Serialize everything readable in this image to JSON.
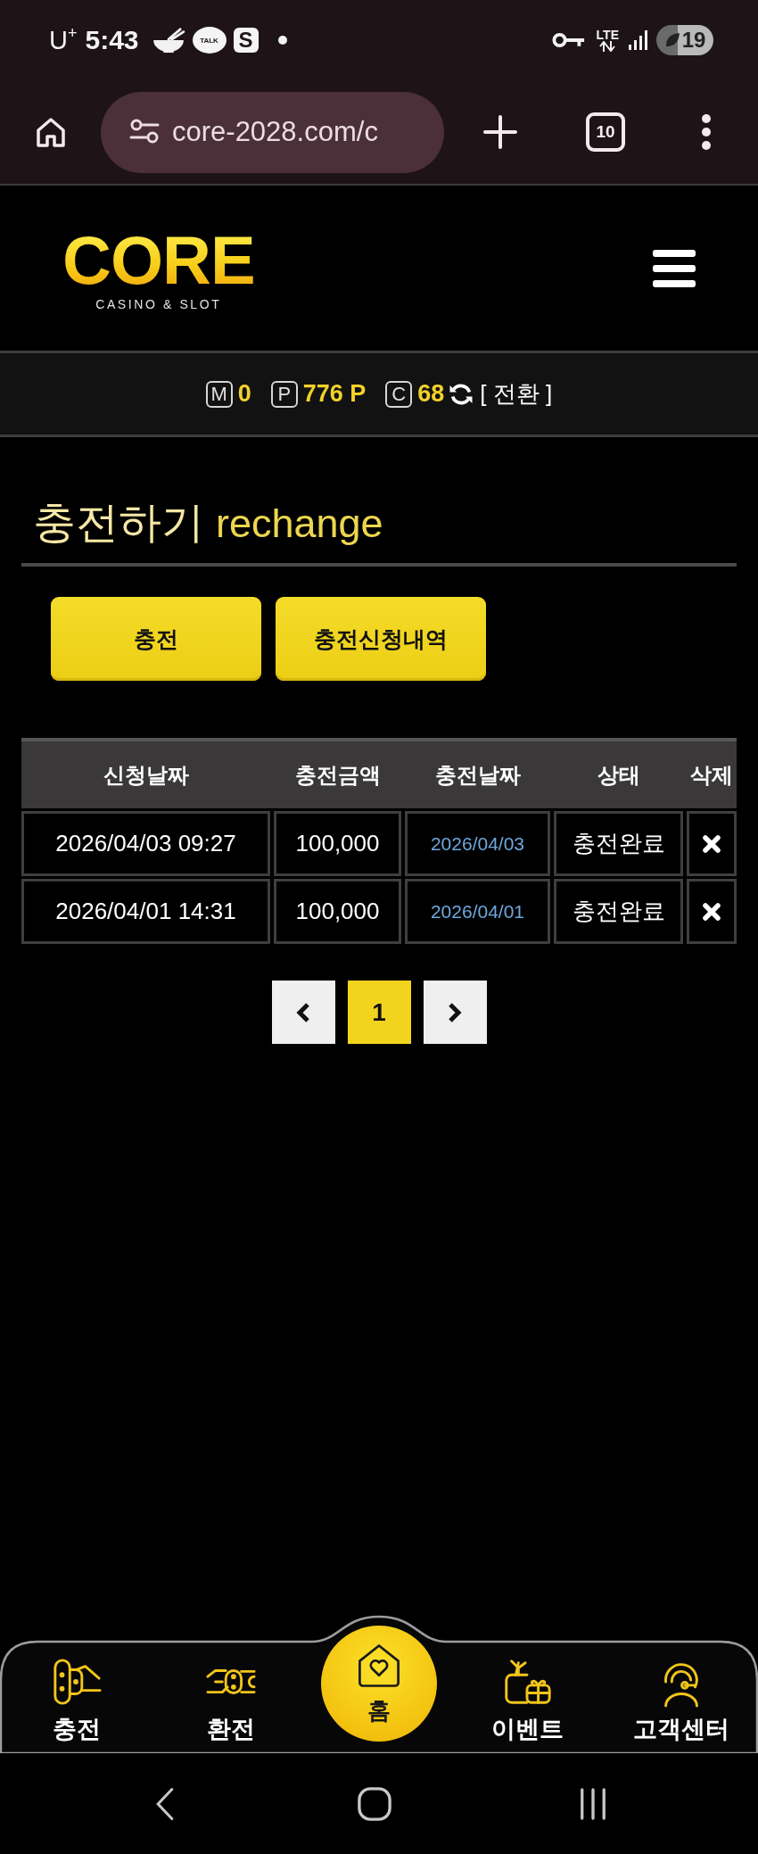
{
  "status_bar": {
    "carrier": "U$^{+}$",
    "time": "5:43",
    "notifications": [
      {
        "kind": "bubble",
        "text": "TALK"
      },
      {
        "kind": "square",
        "text": "S"
      }
    ],
    "network": "LTE",
    "battery": "19"
  },
  "browser": {
    "url": "core-2028.com/c",
    "tab_count": "10"
  },
  "header": {
    "logo": "CORE",
    "logo_tagline": "CASINO & SLOT"
  },
  "balances": {
    "items": [
      {
        "badge": "M",
        "value": "0"
      },
      {
        "badge": "P",
        "value": "776 P"
      },
      {
        "badge": "C",
        "value": "68"
      }
    ],
    "convert_label": "[ 전환 ]"
  },
  "page_title": {
    "title": "충전하기",
    "subtitle": "rechange"
  },
  "buttons": [
    "충전",
    "충전신청내역"
  ],
  "table": {
    "columns": [
      "신청날짜",
      "충전금액",
      "충전날짜",
      "상태",
      "삭제"
    ],
    "rows": [
      {
        "requested_at": "2026/04/03 09:27",
        "amount": "100,000",
        "charged_on": "2026/04/03",
        "status": "충전완료"
      },
      {
        "requested_at": "2026/04/01 14:31",
        "amount": "100,000",
        "charged_on": "2026/04/01",
        "status": "충전완료"
      }
    ]
  },
  "pagination": {
    "pages": [
      {
        "label": "1",
        "selected": true
      }
    ]
  },
  "bottom_nav": {
    "items": [
      {
        "label": "충전",
        "kind": "tab"
      },
      {
        "label": "환전",
        "kind": "tab"
      },
      {
        "label": "홈",
        "kind": "home"
      },
      {
        "label": "이벤트",
        "kind": "tab"
      },
      {
        "label": "고객센터",
        "kind": "tab"
      }
    ]
  }
}
